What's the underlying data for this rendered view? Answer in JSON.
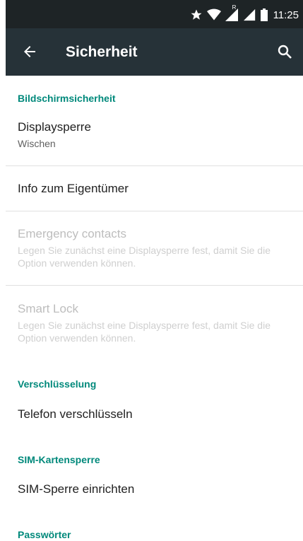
{
  "status_bar": {
    "time": "11:25",
    "roaming_indicator": "R",
    "icons": [
      "star-icon",
      "wifi-icon",
      "signal-icon",
      "battery-icon"
    ]
  },
  "toolbar": {
    "title": "Sicherheit",
    "back_icon": "arrow-back-icon",
    "search_icon": "search-icon"
  },
  "colors": {
    "accent": "#00897b",
    "toolbar": "#263238",
    "status_bar": "#1e2426"
  },
  "sections": {
    "screen_security": {
      "header": "Bildschirmsicherheit",
      "display_lock": {
        "title": "Displaysperre",
        "summary": "Wischen"
      },
      "owner_info": {
        "title": "Info zum Eigentümer"
      },
      "emergency_contacts": {
        "title": "Emergency contacts",
        "summary": "Legen Sie zunächst eine Displaysperre fest, damit Sie die Option verwenden können."
      },
      "smart_lock": {
        "title": "Smart Lock",
        "summary": "Legen Sie zunächst eine Displaysperre fest, damit Sie die Option verwenden können."
      }
    },
    "encryption": {
      "header": "Verschlüsselung",
      "encrypt_phone": {
        "title": "Telefon verschlüsseln"
      }
    },
    "sim_lock": {
      "header": "SIM-Kartensperre",
      "setup_sim_lock": {
        "title": "SIM-Sperre einrichten"
      }
    },
    "passwords": {
      "header": "Passwörter"
    }
  }
}
